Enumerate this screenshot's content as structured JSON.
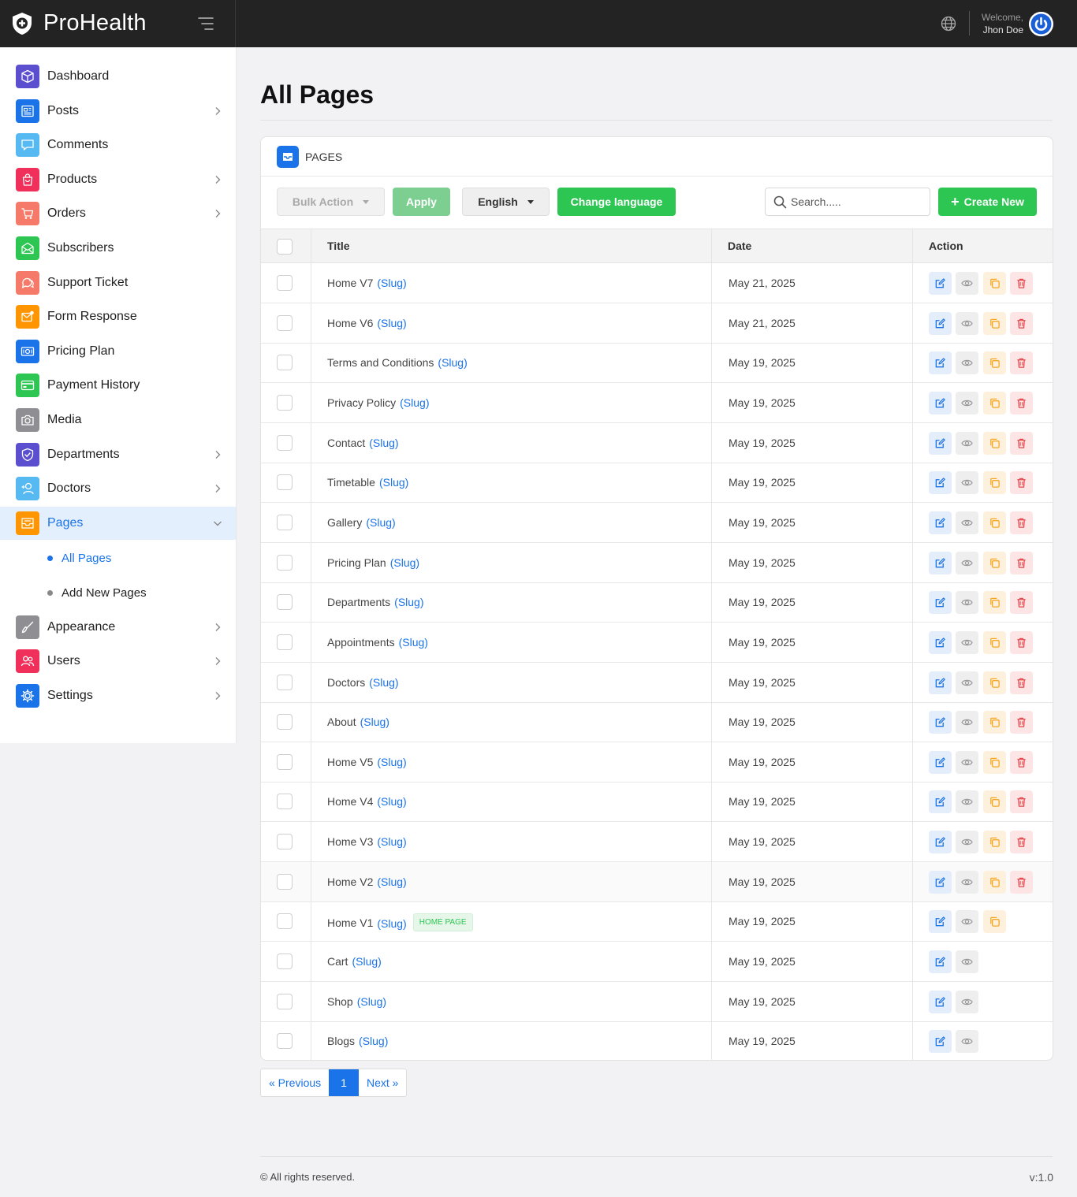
{
  "app": {
    "name": "ProHealth"
  },
  "header": {
    "welcome": "Welcome,",
    "user_name": "Jhon Doe"
  },
  "sidebar": {
    "items": [
      {
        "label": "Dashboard",
        "icon": "cube-icon",
        "color": "#5b4fcf",
        "chevron": false
      },
      {
        "label": "Posts",
        "icon": "newspaper-icon",
        "color": "#1a73e8",
        "chevron": true
      },
      {
        "label": "Comments",
        "icon": "comment-icon",
        "color": "#56b9f2",
        "chevron": false
      },
      {
        "label": "Products",
        "icon": "shopping-bag-icon",
        "color": "#f0305a",
        "chevron": true
      },
      {
        "label": "Orders",
        "icon": "cart-icon",
        "color": "#f57a6a",
        "chevron": true
      },
      {
        "label": "Subscribers",
        "icon": "envelope-open-icon",
        "color": "#2dc653",
        "chevron": false
      },
      {
        "label": "Support Ticket",
        "icon": "chat-bubbles-icon",
        "color": "#f57a6a",
        "chevron": false
      },
      {
        "label": "Form Response",
        "icon": "mail-notification-icon",
        "color": "#ff9500",
        "chevron": false
      },
      {
        "label": "Pricing Plan",
        "icon": "money-icon",
        "color": "#1a73e8",
        "chevron": false
      },
      {
        "label": "Payment History",
        "icon": "credit-card-icon",
        "color": "#2dc653",
        "chevron": false
      },
      {
        "label": "Media",
        "icon": "camera-icon",
        "color": "#8e8e93",
        "chevron": false
      },
      {
        "label": "Departments",
        "icon": "shield-check-icon",
        "color": "#5b4fcf",
        "chevron": true
      },
      {
        "label": "Doctors",
        "icon": "user-plus-icon",
        "color": "#56b9f2",
        "chevron": true
      },
      {
        "label": "Pages",
        "icon": "inbox-icon",
        "color": "#ff9500",
        "chevron": true,
        "expanded": true
      },
      {
        "label": "Appearance",
        "icon": "brush-icon",
        "color": "#8e8e93",
        "chevron": true
      },
      {
        "label": "Users",
        "icon": "users-icon",
        "color": "#f0305a",
        "chevron": true
      },
      {
        "label": "Settings",
        "icon": "gear-icon",
        "color": "#1a73e8",
        "chevron": true
      }
    ],
    "pages_sub": [
      {
        "label": "All Pages",
        "active": true
      },
      {
        "label": "Add New Pages",
        "active": false
      }
    ]
  },
  "main": {
    "title": "All Pages",
    "card_title": "PAGES",
    "toolbar": {
      "bulk_action": "Bulk Action",
      "apply": "Apply",
      "language": "English",
      "change_language": "Change language",
      "search_placeholder": "Search.....",
      "create_new": "Create New"
    },
    "table": {
      "headers": {
        "title": "Title",
        "date": "Date",
        "action": "Action"
      },
      "slug_label": "(Slug)",
      "rows": [
        {
          "title": "Home V7",
          "date": "May 21, 2025",
          "actions": [
            "edit",
            "view",
            "copy",
            "delete"
          ]
        },
        {
          "title": "Home V6",
          "date": "May 21, 2025",
          "actions": [
            "edit",
            "view",
            "copy",
            "delete"
          ]
        },
        {
          "title": "Terms and Conditions",
          "date": "May 19, 2025",
          "actions": [
            "edit",
            "view",
            "copy",
            "delete"
          ]
        },
        {
          "title": "Privacy Policy",
          "date": "May 19, 2025",
          "actions": [
            "edit",
            "view",
            "copy",
            "delete"
          ]
        },
        {
          "title": "Contact",
          "date": "May 19, 2025",
          "actions": [
            "edit",
            "view",
            "copy",
            "delete"
          ]
        },
        {
          "title": "Timetable",
          "date": "May 19, 2025",
          "actions": [
            "edit",
            "view",
            "copy",
            "delete"
          ]
        },
        {
          "title": "Gallery",
          "date": "May 19, 2025",
          "actions": [
            "edit",
            "view",
            "copy",
            "delete"
          ]
        },
        {
          "title": "Pricing Plan",
          "date": "May 19, 2025",
          "actions": [
            "edit",
            "view",
            "copy",
            "delete"
          ]
        },
        {
          "title": "Departments",
          "date": "May 19, 2025",
          "actions": [
            "edit",
            "view",
            "copy",
            "delete"
          ]
        },
        {
          "title": "Appointments",
          "date": "May 19, 2025",
          "actions": [
            "edit",
            "view",
            "copy",
            "delete"
          ]
        },
        {
          "title": "Doctors",
          "date": "May 19, 2025",
          "actions": [
            "edit",
            "view",
            "copy",
            "delete"
          ]
        },
        {
          "title": "About",
          "date": "May 19, 2025",
          "actions": [
            "edit",
            "view",
            "copy",
            "delete"
          ]
        },
        {
          "title": "Home V5",
          "date": "May 19, 2025",
          "actions": [
            "edit",
            "view",
            "copy",
            "delete"
          ]
        },
        {
          "title": "Home V4",
          "date": "May 19, 2025",
          "actions": [
            "edit",
            "view",
            "copy",
            "delete"
          ]
        },
        {
          "title": "Home V3",
          "date": "May 19, 2025",
          "actions": [
            "edit",
            "view",
            "copy",
            "delete"
          ]
        },
        {
          "title": "Home V2",
          "date": "May 19, 2025",
          "actions": [
            "edit",
            "view",
            "copy",
            "delete"
          ],
          "highlighted": true
        },
        {
          "title": "Home V1",
          "date": "May 19, 2025",
          "actions": [
            "edit",
            "view",
            "copy"
          ],
          "badge": "HOME PAGE"
        },
        {
          "title": "Cart",
          "date": "May 19, 2025",
          "actions": [
            "edit",
            "view"
          ]
        },
        {
          "title": "Shop",
          "date": "May 19, 2025",
          "actions": [
            "edit",
            "view"
          ]
        },
        {
          "title": "Blogs",
          "date": "May 19, 2025",
          "actions": [
            "edit",
            "view"
          ]
        }
      ]
    },
    "pagination": {
      "prev": "« Previous",
      "current": "1",
      "next": "Next »"
    }
  },
  "footer": {
    "copyright": "© All rights reserved.",
    "version": "v:1.0"
  },
  "colors": {
    "primary": "#1a73e8",
    "success": "#2dc653",
    "danger": "#e5484d",
    "warning": "#f5a623",
    "topbar": "#232323"
  }
}
